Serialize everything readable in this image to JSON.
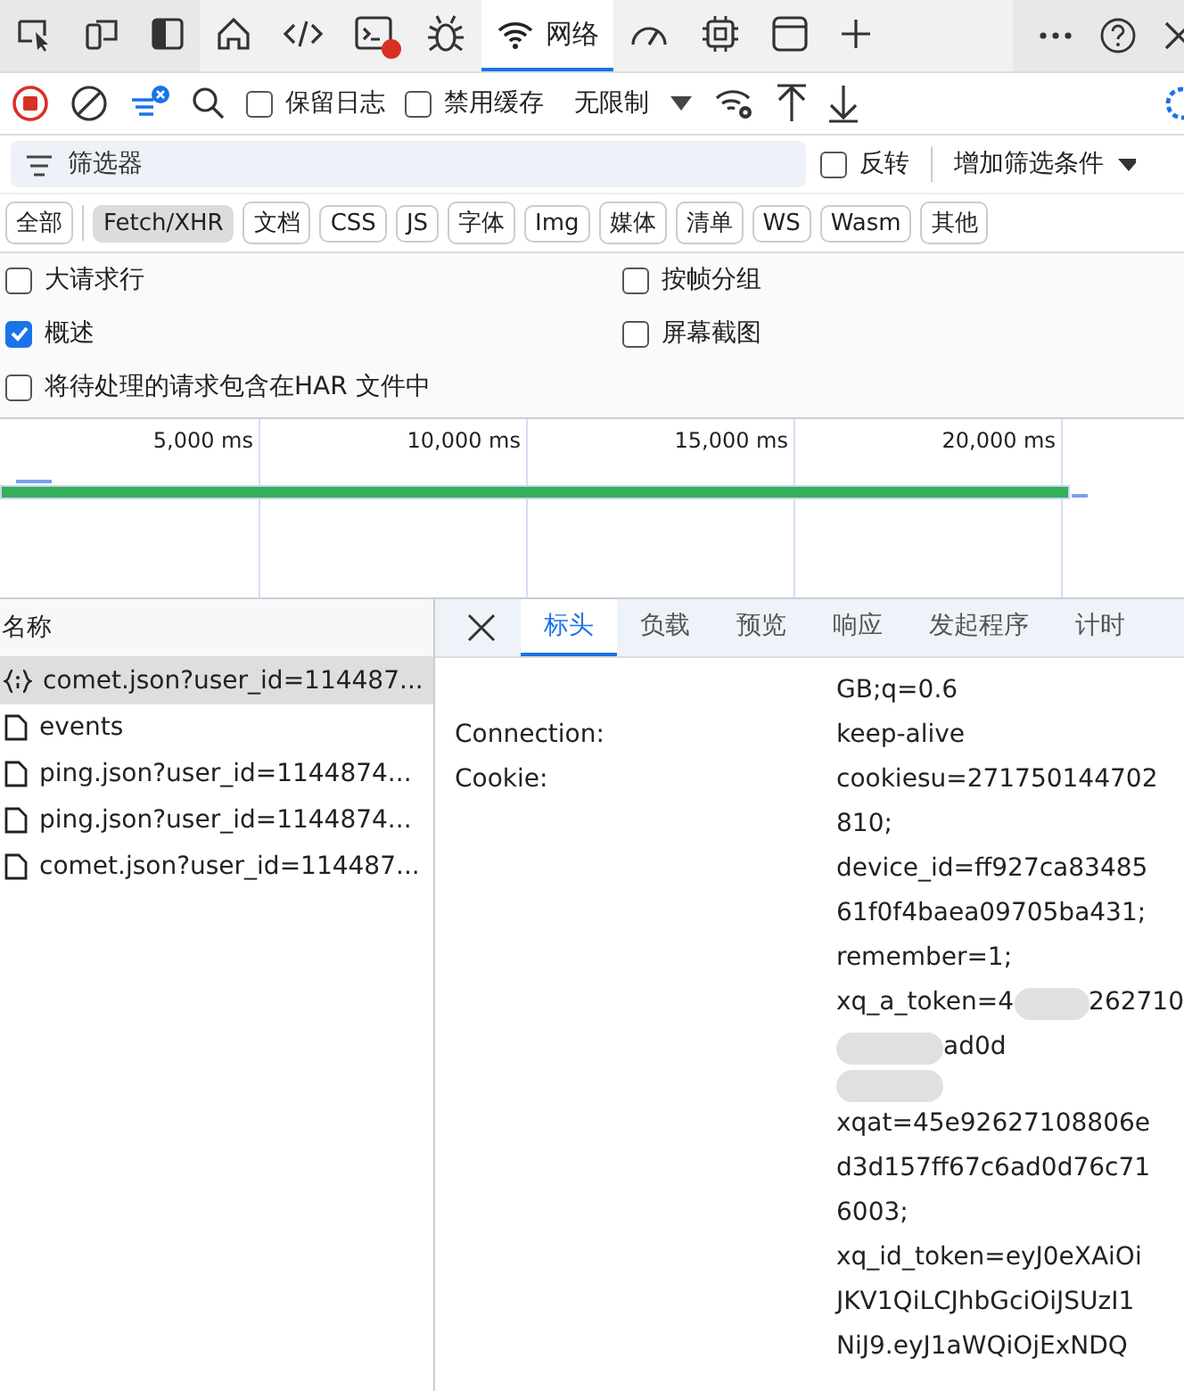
{
  "tool_tabs": [
    {
      "selected": false
    },
    {
      "selected": false
    },
    {
      "selected": false
    },
    {
      "selected": false
    },
    {
      "selected": false
    },
    {
      "selected": false,
      "badge": true
    },
    {
      "selected": false
    },
    {
      "label": "网络",
      "selected": true
    },
    {
      "selected": false
    },
    {
      "selected": false
    },
    {
      "selected": false
    }
  ],
  "toolbar": {
    "recording": true,
    "preserve_log": {
      "label": "保留日志",
      "checked": false
    },
    "disable_cache": {
      "label": "禁用缓存",
      "checked": false
    },
    "throttle": "无限制"
  },
  "filter": {
    "placeholder": "筛选器",
    "invert": {
      "label": "反转",
      "checked": false
    },
    "more_filters": "增加筛选条件"
  },
  "type_filters": [
    {
      "label": "全部",
      "selected": false
    },
    {
      "label": "Fetch/XHR",
      "selected": true
    },
    {
      "label": "文档",
      "selected": false
    },
    {
      "label": "CSS",
      "selected": false
    },
    {
      "label": "JS",
      "selected": false
    },
    {
      "label": "字体",
      "selected": false
    },
    {
      "label": "Img",
      "selected": false
    },
    {
      "label": "媒体",
      "selected": false
    },
    {
      "label": "清单",
      "selected": false
    },
    {
      "label": "WS",
      "selected": false
    },
    {
      "label": "Wasm",
      "selected": false
    },
    {
      "label": "其他",
      "selected": false
    }
  ],
  "options": [
    {
      "label": "大请求行",
      "checked": false
    },
    {
      "label": "按帧分组",
      "checked": false
    },
    {
      "label": "概述",
      "checked": true
    },
    {
      "label": "屏幕截图",
      "checked": false
    },
    {
      "label": "将待处理的请求包含在HAR 文件中",
      "checked": false
    }
  ],
  "timeline": {
    "ticks": [
      "5,000 ms",
      "10,000 ms",
      "15,000 ms",
      "20,000 ms"
    ]
  },
  "requests": {
    "column": "名称",
    "rows": [
      {
        "name": "comet.json?user_id=114487...",
        "kind": "json",
        "selected": true
      },
      {
        "name": "events",
        "kind": "doc",
        "selected": false
      },
      {
        "name": "ping.json?user_id=1144874...",
        "kind": "doc",
        "selected": false
      },
      {
        "name": "ping.json?user_id=1144874...",
        "kind": "doc",
        "selected": false
      },
      {
        "name": "comet.json?user_id=114487...",
        "kind": "doc",
        "selected": false
      }
    ]
  },
  "detail_tabs": [
    {
      "label": "标头",
      "selected": true
    },
    {
      "label": "负载",
      "selected": false
    },
    {
      "label": "预览",
      "selected": false
    },
    {
      "label": "响应",
      "selected": false
    },
    {
      "label": "发起程序",
      "selected": false
    },
    {
      "label": "计时",
      "selected": false
    }
  ],
  "headers": [
    {
      "value_lines": [
        {
          "kind": "text",
          "text": "GB;q=0.6"
        }
      ]
    },
    {
      "name": "Connection:",
      "value_lines": [
        {
          "kind": "text",
          "text": "keep-alive"
        }
      ]
    },
    {
      "name": "Cookie:",
      "value_lines": [
        {
          "kind": "text",
          "text": "cookiesu=271750144702"
        },
        {
          "kind": "text",
          "text": "810;"
        },
        {
          "kind": "text",
          "text": "device_id=ff927ca83485"
        },
        {
          "kind": "text",
          "text": "61f0f4baea09705ba431;"
        },
        {
          "kind": "text",
          "text": "remember=1;"
        },
        {
          "kind": "redacted",
          "before": "xq_a_token=4",
          "after": "262710"
        },
        {
          "kind": "redacted",
          "after": "ad0d"
        },
        {
          "kind": "redacted"
        },
        {
          "kind": "text",
          "text": "xqat=45e92627108806e"
        },
        {
          "kind": "text",
          "text": "d3d157ff67c6ad0d76c71"
        },
        {
          "kind": "text",
          "text": "6003;"
        },
        {
          "kind": "text",
          "text": "xq_id_token=eyJ0eXAiOi"
        },
        {
          "kind": "text",
          "text": "JKV1QiLCJhbGciOiJSUzI1"
        },
        {
          "kind": "text",
          "text": "NiJ9.eyJ1aWQiOjExNDQ"
        }
      ]
    }
  ]
}
